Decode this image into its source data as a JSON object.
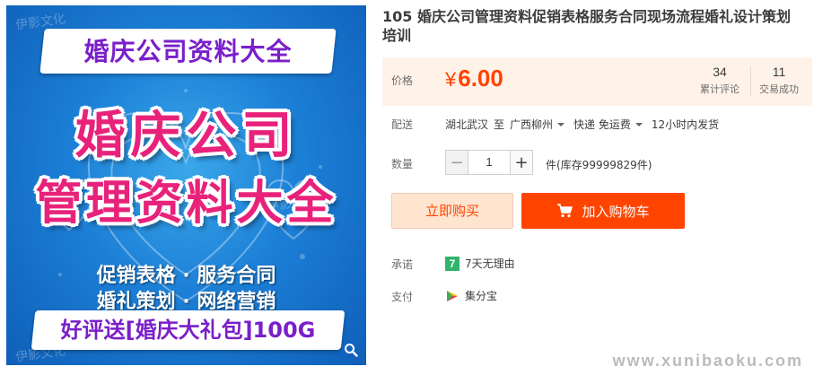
{
  "product_image": {
    "watermark": "伊影文化",
    "top_banner": "婚庆公司资料大全",
    "title_line_1": "婚庆公司",
    "title_line_2": "管理资料大全",
    "feature_line_1": "促销表格 · 服务合同",
    "feature_line_2": "婚礼策划 · 网络营销",
    "bottom_banner": "好评送[婚庆大礼包]100G",
    "zoom_icon": "search-icon"
  },
  "product": {
    "title": "105 婚庆公司管理资料促销表格服务合同现场流程婚礼设计策划培训"
  },
  "price": {
    "label": "价格",
    "currency": "¥",
    "value": "6.00"
  },
  "stats": {
    "reviews_count": "34",
    "reviews_label": "累计评论",
    "sales_count": "11",
    "sales_label": "交易成功"
  },
  "shipping": {
    "label": "配送",
    "origin": "湖北武汉",
    "to": "至",
    "destination": "广西柳州",
    "method": "快递 免运费",
    "dispatch": "12小时内发货"
  },
  "quantity": {
    "label": "数量",
    "value": "1",
    "minus": "−",
    "plus": "+",
    "stock_text": "件(库存99999829件)"
  },
  "actions": {
    "buy_now": "立即购买",
    "add_to_cart": "加入购物车"
  },
  "promise": {
    "label": "承诺",
    "badge": "7",
    "text": "7天无理由"
  },
  "payment": {
    "label": "支付",
    "text": "集分宝"
  },
  "footer": {
    "site_watermark": "www.xunibaoku.com"
  },
  "colors": {
    "accent": "#ff4400",
    "price_bg": "#fff2e8",
    "image_blue": "#1c7fd6",
    "title_pink": "#e8227a",
    "banner_purple": "#7a1fc9"
  }
}
